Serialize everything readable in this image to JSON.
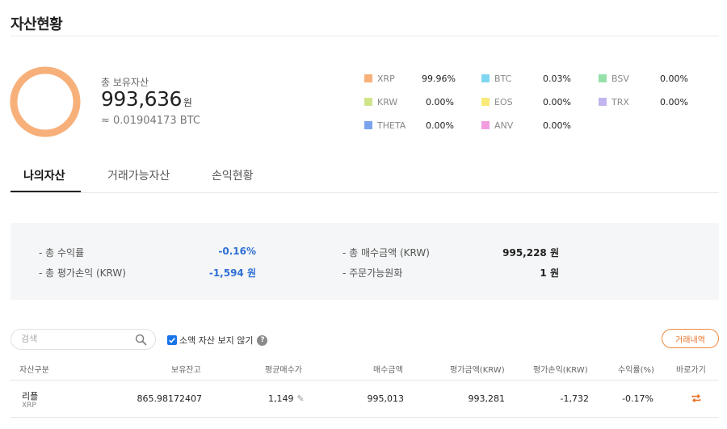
{
  "page": {
    "title": "자산현황"
  },
  "colors": {
    "accent_orange": "#f7b07a",
    "blue_value": "#2f6fd6",
    "history_btn": "#f0883e",
    "checkbox": "#1a73e8"
  },
  "overview": {
    "total_label": "총 보유자산",
    "total_krw": "993,636",
    "total_krw_unit": "원",
    "total_btc": "≈ 0.01904173 BTC",
    "coins": [
      {
        "name": "XRP",
        "pct": "99.96%",
        "color": "#f7b07a"
      },
      {
        "name": "BTC",
        "pct": "0.03%",
        "color": "#7fd6f0"
      },
      {
        "name": "BSV",
        "pct": "0.00%",
        "color": "#94e0a8"
      },
      {
        "name": "KRW",
        "pct": "0.00%",
        "color": "#cfe58a"
      },
      {
        "name": "EOS",
        "pct": "0.00%",
        "color": "#f7ea78"
      },
      {
        "name": "TRX",
        "pct": "0.00%",
        "color": "#c2b4ef"
      },
      {
        "name": "THETA",
        "pct": "0.00%",
        "color": "#7ba4ee"
      },
      {
        "name": "ANV",
        "pct": "0.00%",
        "color": "#f29ce0"
      }
    ]
  },
  "tabs": [
    {
      "label": "나의자산",
      "active": true
    },
    {
      "label": "거래가능자산",
      "active": false
    },
    {
      "label": "손익현황",
      "active": false
    }
  ],
  "summary": {
    "return_rate_label": "- 총 수익률",
    "return_rate_value": "-0.16%",
    "eval_pl_label": "- 총 평가손익 (KRW)",
    "eval_pl_value": "-1,594 원",
    "buy_amount_label": "- 총 매수금액 (KRW)",
    "buy_amount_value": "995,228 원",
    "orderable_label": "- 주문가능원화",
    "orderable_value": "1 원"
  },
  "filters": {
    "search_placeholder": "검색",
    "hide_small_label": "소액 자산 보지 않기",
    "help_glyph": "?",
    "history_button": "거래내역"
  },
  "table": {
    "headers": [
      "자산구분",
      "보유잔고",
      "평균매수가",
      "매수금액",
      "평가금액(KRW)",
      "평가손익(KRW)",
      "수익률(%)",
      "바로가기"
    ],
    "rows": [
      {
        "name": "리플",
        "ticker": "XRP",
        "balance": "865.98172407",
        "avg_price": "1,149",
        "buy_amount": "995,013",
        "eval_amount": "993,281",
        "eval_pl": "-1,732",
        "return_rate": "-0.17%"
      }
    ]
  }
}
